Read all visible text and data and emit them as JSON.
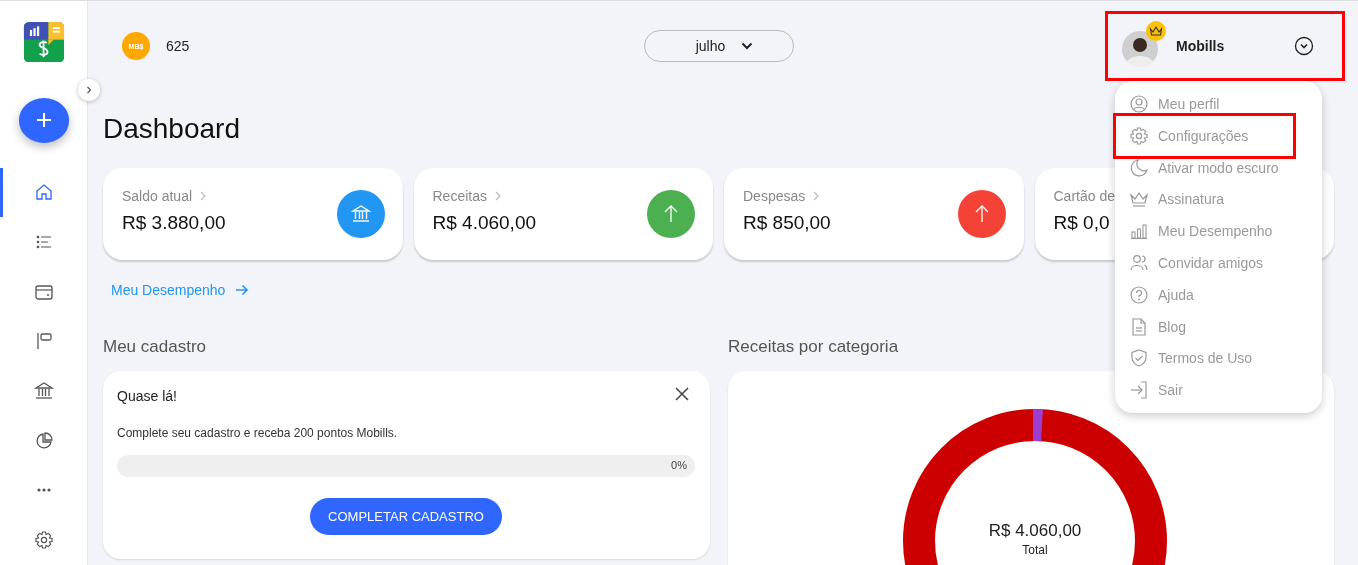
{
  "sidebar": {
    "items": [
      {
        "kind": "home",
        "selected": true
      },
      {
        "kind": "list",
        "selected": false
      },
      {
        "kind": "wallet",
        "selected": false
      },
      {
        "kind": "flag",
        "selected": false
      },
      {
        "kind": "bank",
        "selected": false
      },
      {
        "kind": "chart",
        "selected": false
      },
      {
        "kind": "more",
        "selected": false
      },
      {
        "kind": "settings",
        "selected": false
      }
    ]
  },
  "header": {
    "coin_label": "MB$",
    "points": "625",
    "month": "julho",
    "user": {
      "name": "Mobills",
      "highlighted": true
    }
  },
  "title": "Dashboard",
  "cards": [
    {
      "label": "Saldo atual",
      "value": "R$ 3.880,00",
      "kind": "bank",
      "color": "#2196f3"
    },
    {
      "label": "Receitas",
      "value": "R$ 4.060,00",
      "kind": "up",
      "color": "#4caf50"
    },
    {
      "label": "Despesas",
      "value": "R$ 850,00",
      "kind": "up",
      "color": "#f44336"
    },
    {
      "label": "Cartão de",
      "value": "R$ 0,0",
      "kind": "none"
    }
  ],
  "performance_link": "Meu Desempenho",
  "registration": {
    "title": "Meu cadastro",
    "heading": "Quase lá!",
    "text": "Complete seu cadastro e receba 200 pontos Mobills.",
    "level": 0,
    "percent": "0%",
    "button": "COMPLETAR CADASTRO"
  },
  "income": {
    "title": "Receitas por categoria",
    "total": "R$ 4.060,00",
    "total_label": "Total"
  },
  "user_menu": [
    {
      "label": "Meu perfil",
      "kind": "user",
      "highlighted": false
    },
    {
      "label": "Configurações",
      "kind": "gear",
      "highlighted": true
    },
    {
      "label": "Ativar modo escuro",
      "kind": "moon",
      "highlighted": false
    },
    {
      "label": "Assinatura",
      "kind": "crown",
      "highlighted": false
    },
    {
      "label": "Meu Desempenho",
      "kind": "bars",
      "highlighted": false
    },
    {
      "label": "Convidar amigos",
      "kind": "people",
      "highlighted": false
    },
    {
      "label": "Ajuda",
      "kind": "help",
      "highlighted": false
    },
    {
      "label": "Blog",
      "kind": "doc",
      "highlighted": false
    },
    {
      "label": "Termos de Uso",
      "kind": "shield",
      "highlighted": false
    },
    {
      "label": "Sair",
      "kind": "exit",
      "highlighted": false
    }
  ]
}
